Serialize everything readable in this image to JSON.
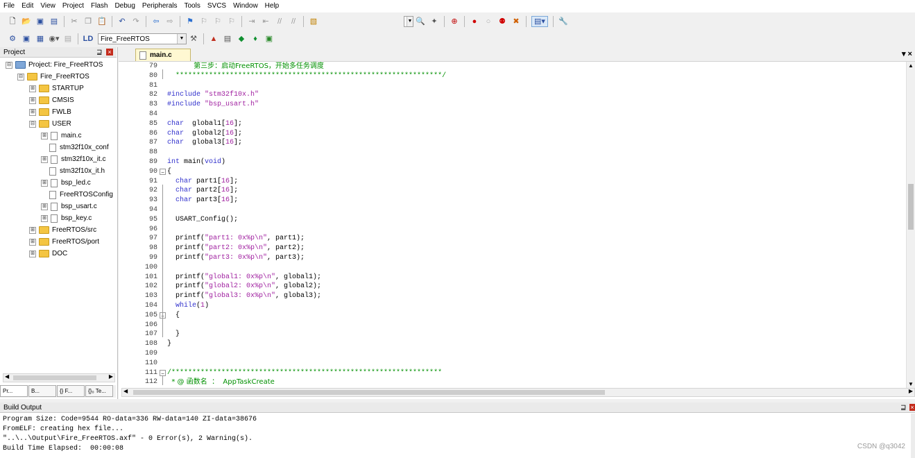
{
  "menu": [
    "File",
    "Edit",
    "View",
    "Project",
    "Flash",
    "Debug",
    "Peripherals",
    "Tools",
    "SVCS",
    "Window",
    "Help"
  ],
  "toolbar": {
    "target_name": "Fire_FreeRTOS"
  },
  "project_panel": {
    "title": "Project",
    "pin_glyph": "⊒",
    "close_glyph": "×",
    "tree": [
      {
        "label": "Project: Fire_FreeRTOS",
        "level": 0,
        "type": "project",
        "exp": "⊟"
      },
      {
        "label": "Fire_FreeRTOS",
        "level": 1,
        "type": "folder-open",
        "exp": "⊟"
      },
      {
        "label": "STARTUP",
        "level": 2,
        "type": "folder",
        "exp": "⊞"
      },
      {
        "label": "CMSIS",
        "level": 2,
        "type": "folder",
        "exp": "⊞"
      },
      {
        "label": "FWLB",
        "level": 2,
        "type": "folder",
        "exp": "⊞"
      },
      {
        "label": "USER",
        "level": 2,
        "type": "folder-open",
        "exp": "⊟"
      },
      {
        "label": "main.c",
        "level": 3,
        "type": "file",
        "exp": "⊞"
      },
      {
        "label": "stm32f10x_conf",
        "level": 3,
        "type": "file",
        "exp": ""
      },
      {
        "label": "stm32f10x_it.c",
        "level": 3,
        "type": "file",
        "exp": "⊞"
      },
      {
        "label": "stm32f10x_it.h",
        "level": 3,
        "type": "file",
        "exp": ""
      },
      {
        "label": "bsp_led.c",
        "level": 3,
        "type": "file",
        "exp": "⊞"
      },
      {
        "label": "FreeRTOSConfig",
        "level": 3,
        "type": "file",
        "exp": ""
      },
      {
        "label": "bsp_usart.c",
        "level": 3,
        "type": "file",
        "exp": "⊞"
      },
      {
        "label": "bsp_key.c",
        "level": 3,
        "type": "file",
        "exp": "⊞"
      },
      {
        "label": "FreeRTOS/src",
        "level": 2,
        "type": "folder",
        "exp": "⊞"
      },
      {
        "label": "FreeRTOS/port",
        "level": 2,
        "type": "folder",
        "exp": "⊞"
      },
      {
        "label": "DOC",
        "level": 2,
        "type": "folder",
        "exp": "⊞"
      }
    ],
    "tabs": [
      "Pr...",
      "B...",
      "{} F...",
      "{}₀ Te..."
    ]
  },
  "editor": {
    "tab_label": "main.c",
    "close_all_glyph": "▾ ×",
    "lines": [
      {
        "n": "79",
        "t": [
          [
            "cn",
            "            第三步：启动FreeRTOS，开始多任务调度"
          ]
        ]
      },
      {
        "n": "80",
        "t": [
          [
            "cm",
            "  ****************************************************************/"
          ]
        ]
      },
      {
        "n": "81",
        "t": []
      },
      {
        "n": "82",
        "t": [
          [
            "pp",
            "#include "
          ],
          [
            "str",
            "\"stm32f10x.h\""
          ]
        ]
      },
      {
        "n": "83",
        "t": [
          [
            "pp",
            "#include "
          ],
          [
            "str",
            "\"bsp_usart.h\""
          ]
        ]
      },
      {
        "n": "84",
        "t": []
      },
      {
        "n": "85",
        "t": [
          [
            "kw",
            "char"
          ],
          [
            "",
            "  global1["
          ],
          [
            "num",
            "16"
          ],
          [
            "",
            "];"
          ]
        ]
      },
      {
        "n": "86",
        "t": [
          [
            "kw",
            "char"
          ],
          [
            "",
            "  global2["
          ],
          [
            "num",
            "16"
          ],
          [
            "",
            "];"
          ]
        ]
      },
      {
        "n": "87",
        "t": [
          [
            "kw",
            "char"
          ],
          [
            "",
            "  global3["
          ],
          [
            "num",
            "16"
          ],
          [
            "",
            "];"
          ]
        ]
      },
      {
        "n": "88",
        "t": []
      },
      {
        "n": "89",
        "t": [
          [
            "kw",
            "int"
          ],
          [
            "",
            " main("
          ],
          [
            "kw",
            "void"
          ],
          [
            "",
            ")"
          ]
        ]
      },
      {
        "n": "90",
        "t": [
          [
            "",
            "{"
          ]
        ],
        "fold": "−"
      },
      {
        "n": "91",
        "t": [
          [
            "",
            "  "
          ],
          [
            "kw",
            "char"
          ],
          [
            "",
            " part1["
          ],
          [
            "num",
            "16"
          ],
          [
            "",
            "];"
          ]
        ]
      },
      {
        "n": "92",
        "t": [
          [
            "",
            "  "
          ],
          [
            "kw",
            "char"
          ],
          [
            "",
            " part2["
          ],
          [
            "num",
            "16"
          ],
          [
            "",
            "];"
          ]
        ]
      },
      {
        "n": "93",
        "t": [
          [
            "",
            "  "
          ],
          [
            "kw",
            "char"
          ],
          [
            "",
            " part3["
          ],
          [
            "num",
            "16"
          ],
          [
            "",
            "];"
          ]
        ]
      },
      {
        "n": "94",
        "t": []
      },
      {
        "n": "95",
        "t": [
          [
            "",
            "  USART_Config();"
          ]
        ]
      },
      {
        "n": "96",
        "t": []
      },
      {
        "n": "97",
        "t": [
          [
            "",
            "  printf("
          ],
          [
            "str",
            "\"part1: 0x%p\\n\""
          ],
          [
            "",
            ", part1);"
          ]
        ]
      },
      {
        "n": "98",
        "t": [
          [
            "",
            "  printf("
          ],
          [
            "str",
            "\"part2: 0x%p\\n\""
          ],
          [
            "",
            ", part2);"
          ]
        ]
      },
      {
        "n": "99",
        "t": [
          [
            "",
            "  printf("
          ],
          [
            "str",
            "\"part3: 0x%p\\n\""
          ],
          [
            "",
            ", part3);"
          ]
        ]
      },
      {
        "n": "100",
        "t": []
      },
      {
        "n": "101",
        "t": [
          [
            "",
            "  printf("
          ],
          [
            "str",
            "\"global1: 0x%p\\n\""
          ],
          [
            "",
            ", global1);"
          ]
        ]
      },
      {
        "n": "102",
        "t": [
          [
            "",
            "  printf("
          ],
          [
            "str",
            "\"global2: 0x%p\\n\""
          ],
          [
            "",
            ", global2);"
          ]
        ]
      },
      {
        "n": "103",
        "t": [
          [
            "",
            "  printf("
          ],
          [
            "str",
            "\"global3: 0x%p\\n\""
          ],
          [
            "",
            ", global3);"
          ]
        ]
      },
      {
        "n": "104",
        "t": [
          [
            "",
            "  "
          ],
          [
            "kw",
            "while"
          ],
          [
            "",
            "("
          ],
          [
            "num",
            "1"
          ],
          [
            "",
            ")"
          ]
        ]
      },
      {
        "n": "105",
        "t": [
          [
            "",
            "  {"
          ]
        ],
        "fold": "−"
      },
      {
        "n": "106",
        "t": []
      },
      {
        "n": "107",
        "t": [
          [
            "",
            "  }"
          ]
        ]
      },
      {
        "n": "108",
        "t": [
          [
            "",
            "}"
          ]
        ]
      },
      {
        "n": "109",
        "t": []
      },
      {
        "n": "110",
        "t": []
      },
      {
        "n": "111",
        "t": [
          [
            "cm",
            "/*****************************************************************"
          ]
        ],
        "fold": "−"
      },
      {
        "n": "112",
        "t": [
          [
            "cn",
            "  * @ 函数名  ：  AppTaskCreate"
          ]
        ]
      }
    ]
  },
  "build_output": {
    "title": "Build Output",
    "lines": [
      "Program Size: Code=9544 RO-data=336 RW-data=140 ZI-data=38676",
      "FromELF: creating hex file...",
      "\"..\\..\\Output\\Fire_FreeRTOS.axf\" - 0 Error(s), 2 Warning(s).",
      "Build Time Elapsed:  00:00:08"
    ]
  },
  "watermark": "CSDN @q3042"
}
